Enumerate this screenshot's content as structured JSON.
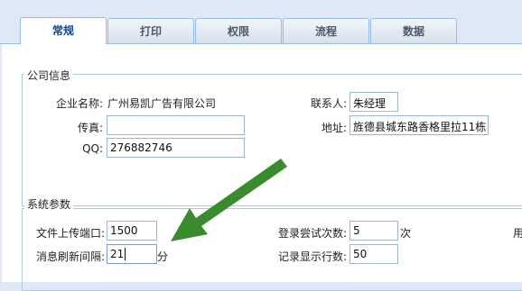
{
  "tabs": [
    "常规",
    "打印",
    "权限",
    "流程",
    "数据"
  ],
  "company": {
    "legend": "公司信息",
    "name_label": "企业名称:",
    "name_value": "广州易凯广告有限公司",
    "fax_label": "传真:",
    "fax_value": "",
    "qq_label": "QQ:",
    "qq_value": "276882746",
    "contact_label": "联系人:",
    "contact_value": "朱经理",
    "address_label": "地址:",
    "address_value": "旌德县城东路香格里拉11栋"
  },
  "system": {
    "legend": "系统参数",
    "upload_port_label": "文件上传端口:",
    "upload_port_value": "1500",
    "refresh_label": "消息刷新间隔:",
    "refresh_value": "21",
    "refresh_unit": "分",
    "login_tries_label": "登录尝试次数:",
    "login_tries_value": "5",
    "login_tries_unit": "次",
    "rows_label": "记录显示行数:",
    "rows_value": "50",
    "clipped_right": "用"
  },
  "colors": {
    "arrow": "#3a8a2e",
    "tab_active_text": "#15428b"
  }
}
